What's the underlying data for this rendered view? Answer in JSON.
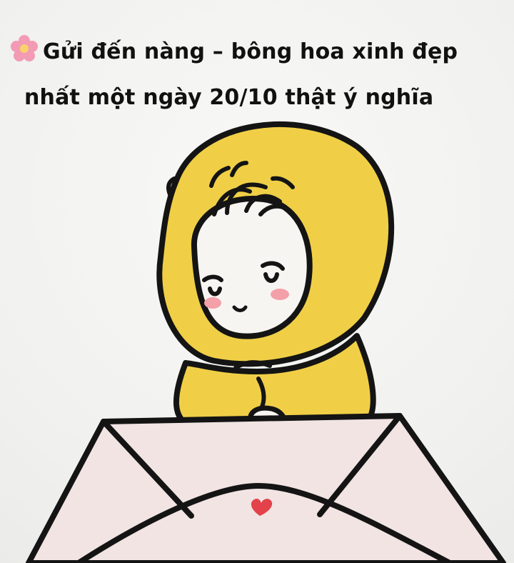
{
  "caption": {
    "line1": "Gửi đến nàng – bông hoa xinh đẹp",
    "line2": "nhất một ngày 20/10 thật ý nghĩa"
  },
  "icons": {
    "caption_icon": "cherry-blossom-icon",
    "seal_icon": "heart-icon"
  },
  "colors": {
    "background": "#f3f3f1",
    "hood": "#f0cf47",
    "face": "#f7f5f2",
    "blush": "#f3a0a8",
    "envelope": "#f1e4e2",
    "heart": "#e3424a",
    "flower": "#f39bb4",
    "ink": "#141414"
  }
}
